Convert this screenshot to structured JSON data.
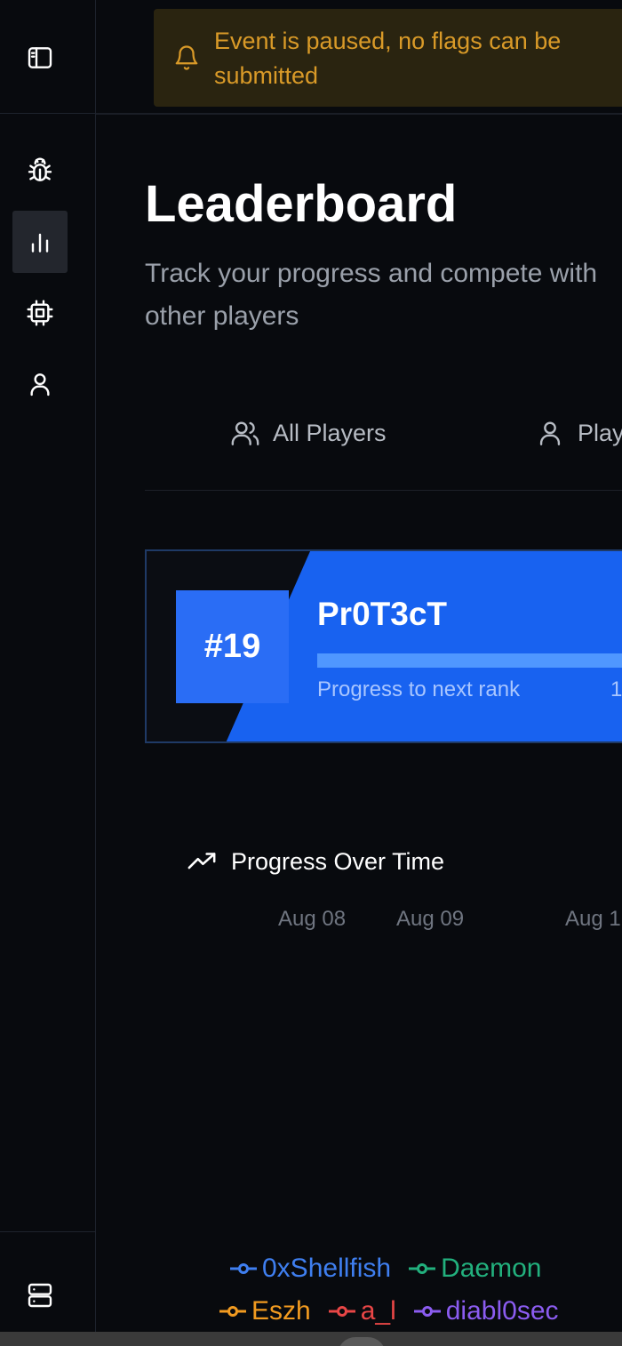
{
  "banner": {
    "text": "Event is paused, no flags can be submitted",
    "icon": "bell-icon",
    "color": "#d99a28"
  },
  "sidebar": {
    "toggle_icon": "sidebar-toggle-icon",
    "items": [
      {
        "name": "bug-icon",
        "active": false
      },
      {
        "name": "bar-chart-icon",
        "active": true
      },
      {
        "name": "chip-icon",
        "active": false
      },
      {
        "name": "user-icon",
        "active": false
      }
    ],
    "bottom_icon": "server-icon"
  },
  "page": {
    "title": "Leaderboard",
    "subtitle": "Track your progress and compete with other players"
  },
  "tabs": [
    {
      "label": "All Players",
      "icon": "users-icon"
    },
    {
      "label": "Players",
      "icon": "user-icon"
    }
  ],
  "rank_card": {
    "rank": "#19",
    "player": "Pr0T3cT",
    "progress_label": "Progress to next rank",
    "progress_value": "1",
    "progress_fraction": 0.92,
    "accent": "#1862f0"
  },
  "chart": {
    "title": "Progress Over Time",
    "icon": "trending-up-icon",
    "x_ticks": [
      "Aug 08",
      "Aug 09",
      "Aug 1"
    ]
  },
  "legend": [
    {
      "name": "0xShellfish",
      "color": "#3f7ff0"
    },
    {
      "name": "Daemon",
      "color": "#22b07d"
    },
    {
      "name": "Eszh",
      "color": "#f29b20"
    },
    {
      "name": "a_l",
      "color": "#e84646"
    },
    {
      "name": "diabl0sec",
      "color": "#8b5cf0"
    }
  ]
}
